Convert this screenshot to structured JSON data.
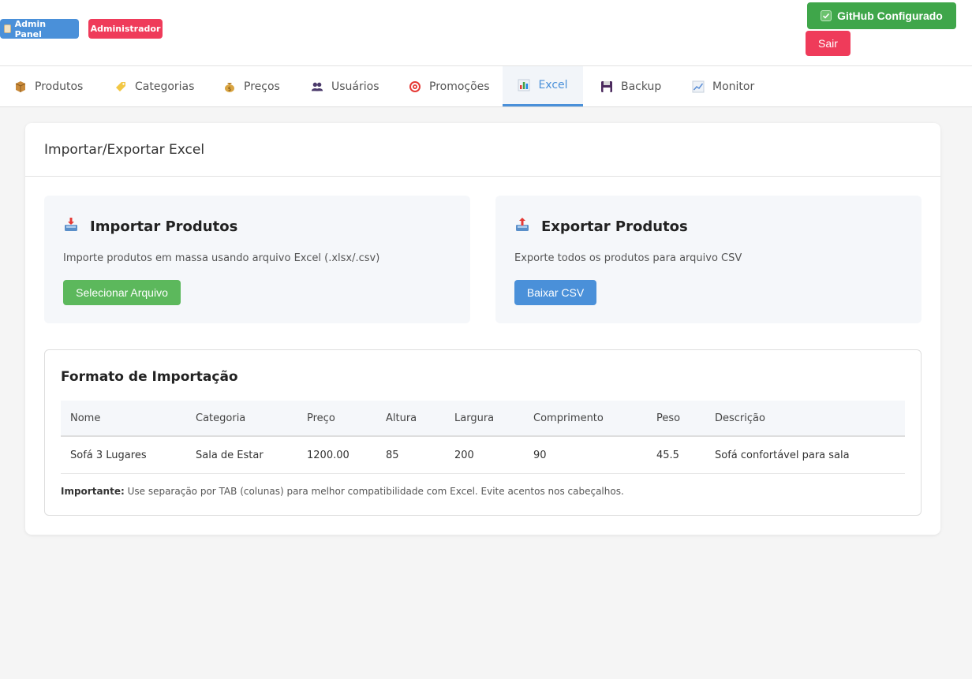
{
  "header": {
    "admin_badge": "Admin Panel",
    "role_badge": "Administrador",
    "github_button": "GitHub Configurado",
    "logout_button": "Sair"
  },
  "nav": {
    "items": [
      {
        "label": "Produtos",
        "icon": "package-icon"
      },
      {
        "label": "Categorias",
        "icon": "tag-icon"
      },
      {
        "label": "Preços",
        "icon": "money-bag-icon"
      },
      {
        "label": "Usuários",
        "icon": "users-icon"
      },
      {
        "label": "Promoções",
        "icon": "target-icon"
      },
      {
        "label": "Excel",
        "icon": "bar-chart-icon",
        "active": true
      },
      {
        "label": "Backup",
        "icon": "floppy-disk-icon"
      },
      {
        "label": "Monitor",
        "icon": "line-chart-icon"
      }
    ]
  },
  "main": {
    "title": "Importar/Exportar Excel",
    "import": {
      "title": "Importar Produtos",
      "description": "Importe produtos em massa usando arquivo Excel (.xlsx/.csv)",
      "button": "Selecionar Arquivo"
    },
    "export": {
      "title": "Exportar Produtos",
      "description": "Exporte todos os produtos para arquivo CSV",
      "button": "Baixar CSV"
    },
    "format": {
      "title": "Formato de Importação",
      "columns": [
        "Nome",
        "Categoria",
        "Preço",
        "Altura",
        "Largura",
        "Comprimento",
        "Peso",
        "Descrição"
      ],
      "rows": [
        [
          "Sofá 3 Lugares",
          "Sala de Estar",
          "1200.00",
          "85",
          "200",
          "90",
          "45.5",
          "Sofá confortável para sala"
        ]
      ],
      "note_label": "Importante:",
      "note_text": " Use separação por TAB (colunas) para melhor compatibilidade com Excel. Evite acentos nos cabeçalhos."
    }
  },
  "colors": {
    "primary": "#4a90d9",
    "success": "#3fa64a",
    "danger": "#ef3b5a",
    "select_button": "#5cb85c"
  }
}
